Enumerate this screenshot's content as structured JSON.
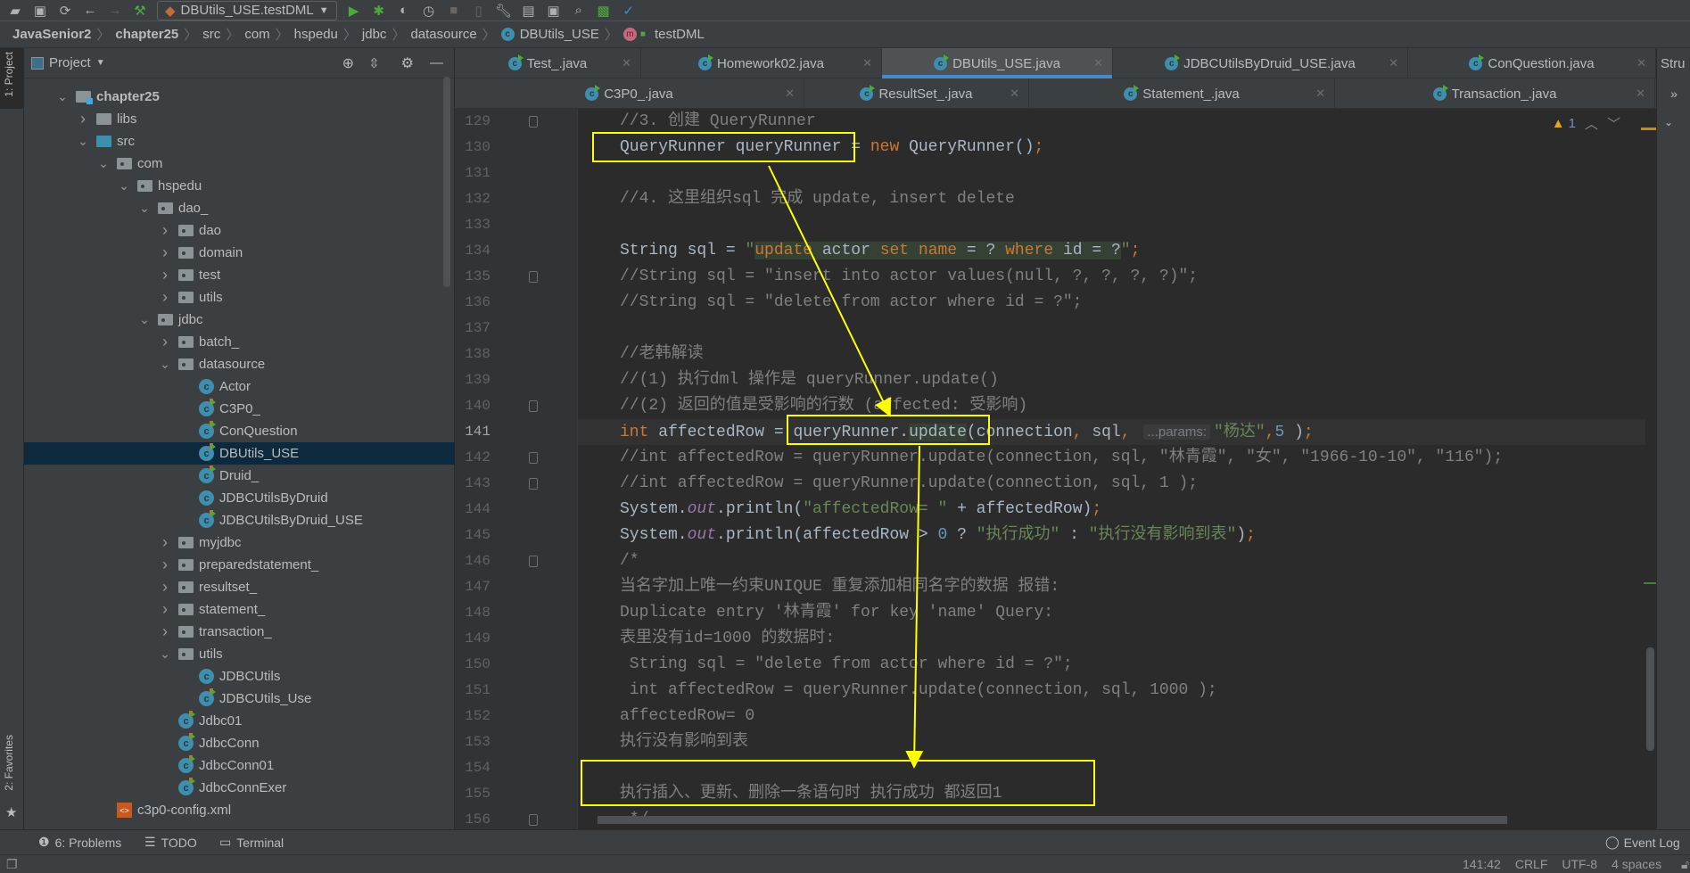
{
  "toolbar": {
    "run_config": "DBUtils_USE.testDML"
  },
  "breadcrumb": [
    "JavaSenior2",
    "chapter25",
    "src",
    "com",
    "hspedu",
    "jdbc",
    "datasource",
    "DBUtils_USE",
    "testDML"
  ],
  "left_strip": {
    "project_tab": "1: Project",
    "favorites_tab": "2: Favorites"
  },
  "project_panel": {
    "title": "Project",
    "tree": [
      {
        "label": "chapter25",
        "level": 0,
        "kind": "module",
        "expanded": true
      },
      {
        "label": "libs",
        "level": 1,
        "kind": "folder",
        "expanded": false
      },
      {
        "label": "src",
        "level": 1,
        "kind": "src",
        "expanded": true
      },
      {
        "label": "com",
        "level": 2,
        "kind": "pkg",
        "expanded": true
      },
      {
        "label": "hspedu",
        "level": 3,
        "kind": "pkg",
        "expanded": true
      },
      {
        "label": "dao_",
        "level": 4,
        "kind": "pkg",
        "expanded": true
      },
      {
        "label": "dao",
        "level": 5,
        "kind": "pkg",
        "expanded": false
      },
      {
        "label": "domain",
        "level": 5,
        "kind": "pkg",
        "expanded": false
      },
      {
        "label": "test",
        "level": 5,
        "kind": "pkg",
        "expanded": false
      },
      {
        "label": "utils",
        "level": 5,
        "kind": "pkg",
        "expanded": false
      },
      {
        "label": "jdbc",
        "level": 4,
        "kind": "pkg",
        "expanded": true
      },
      {
        "label": "batch_",
        "level": 5,
        "kind": "pkg",
        "expanded": false
      },
      {
        "label": "datasource",
        "level": 5,
        "kind": "pkg",
        "expanded": true
      },
      {
        "label": "Actor",
        "level": 6,
        "kind": "class"
      },
      {
        "label": "C3P0_",
        "level": 6,
        "kind": "class-run"
      },
      {
        "label": "ConQuestion",
        "level": 6,
        "kind": "class-run"
      },
      {
        "label": "DBUtils_USE",
        "level": 6,
        "kind": "class-run",
        "selected": true
      },
      {
        "label": "Druid_",
        "level": 6,
        "kind": "class-run"
      },
      {
        "label": "JDBCUtilsByDruid",
        "level": 6,
        "kind": "class"
      },
      {
        "label": "JDBCUtilsByDruid_USE",
        "level": 6,
        "kind": "class-run"
      },
      {
        "label": "myjdbc",
        "level": 5,
        "kind": "pkg",
        "expanded": false
      },
      {
        "label": "preparedstatement_",
        "level": 5,
        "kind": "pkg",
        "expanded": false
      },
      {
        "label": "resultset_",
        "level": 5,
        "kind": "pkg",
        "expanded": false
      },
      {
        "label": "statement_",
        "level": 5,
        "kind": "pkg",
        "expanded": false
      },
      {
        "label": "transaction_",
        "level": 5,
        "kind": "pkg",
        "expanded": false
      },
      {
        "label": "utils",
        "level": 5,
        "kind": "pkg",
        "expanded": true
      },
      {
        "label": "JDBCUtils",
        "level": 6,
        "kind": "class"
      },
      {
        "label": "JDBCUtils_Use",
        "level": 6,
        "kind": "class-run"
      },
      {
        "label": "Jdbc01",
        "level": 5,
        "kind": "class-run"
      },
      {
        "label": "JdbcConn",
        "level": 5,
        "kind": "class-run"
      },
      {
        "label": "JdbcConn01",
        "level": 5,
        "kind": "class-run"
      },
      {
        "label": "JdbcConnExer",
        "level": 5,
        "kind": "class-run"
      },
      {
        "label": "c3p0-config.xml",
        "level": 2,
        "kind": "xml"
      }
    ]
  },
  "tabs_row1": [
    {
      "label": "Test_.java",
      "w": 209
    },
    {
      "label": "Homework02.java",
      "w": 270
    },
    {
      "label": "DBUtils_USE.java",
      "w": 259,
      "active": true
    },
    {
      "label": "JDBCUtilsByDruid_USE.java",
      "w": 331
    },
    {
      "label": "ConQuestion.java",
      "w": 278
    }
  ],
  "tabs_row2": [
    {
      "label": "C3P0_.java",
      "w": 392
    },
    {
      "label": "ResultSet_.java",
      "w": 252
    },
    {
      "label": "Statement_.java",
      "w": 343
    },
    {
      "label": "Transaction_.java",
      "w": 359
    }
  ],
  "structure_tab": "Stru",
  "more_tabs": "»",
  "editor": {
    "warning_count": "1",
    "current_line": 141,
    "folds": [
      129,
      135,
      140,
      142,
      143,
      146,
      156
    ],
    "lines": [
      {
        "n": 129,
        "tokens": [
          {
            "t": "//3. 创建 QueryRunner",
            "c": "cm"
          }
        ]
      },
      {
        "n": 130,
        "tokens": [
          {
            "t": "QueryRunner queryRunner = "
          },
          {
            "t": "new ",
            "c": "kw"
          },
          {
            "t": "QueryRunner()"
          },
          {
            "t": ";",
            "c": "kw"
          }
        ]
      },
      {
        "n": 131,
        "tokens": []
      },
      {
        "n": 132,
        "tokens": [
          {
            "t": "//4. 这里组织sql 完成 update, insert delete",
            "c": "cm"
          }
        ]
      },
      {
        "n": 133,
        "tokens": []
      },
      {
        "n": 134,
        "tokens": [
          {
            "t": "String sql = "
          },
          {
            "t": "\"",
            "c": "str"
          },
          {
            "t": "update",
            "c": "kw sqlbg"
          },
          {
            "t": " actor ",
            "c": "sqlbg"
          },
          {
            "t": "set name",
            "c": "kw sqlbg"
          },
          {
            "t": " = ? ",
            "c": "sqlbg"
          },
          {
            "t": "where",
            "c": "kw sqlbg"
          },
          {
            "t": " id = ?",
            "c": "sqlbg"
          },
          {
            "t": "\"",
            "c": "str"
          },
          {
            "t": ";",
            "c": "kw"
          }
        ]
      },
      {
        "n": 135,
        "tokens": [
          {
            "t": "//String sql = \"insert into actor values(null, ?, ?, ?, ?)\";",
            "c": "cm"
          }
        ]
      },
      {
        "n": 136,
        "tokens": [
          {
            "t": "//String sql = \"delete from actor where id = ?\";",
            "c": "cm"
          }
        ]
      },
      {
        "n": 137,
        "tokens": []
      },
      {
        "n": 138,
        "tokens": [
          {
            "t": "//老韩解读",
            "c": "cm"
          }
        ]
      },
      {
        "n": 139,
        "tokens": [
          {
            "t": "//(1) 执行dml 操作是 queryRunner.update()",
            "c": "cm"
          }
        ]
      },
      {
        "n": 140,
        "tokens": [
          {
            "t": "//(2) 返回的值是受影响的行数 (affected: 受影响)",
            "c": "cm"
          }
        ]
      },
      {
        "n": 141,
        "tokens": [
          {
            "t": "int ",
            "c": "kw"
          },
          {
            "t": "affectedRow = queryRunner."
          },
          {
            "t": "update",
            "c": "upd"
          },
          {
            "t": "(connection"
          },
          {
            "t": ", ",
            "c": "kw"
          },
          {
            "t": "sql"
          },
          {
            "t": ", ",
            "c": "kw"
          },
          {
            "t": "...params:",
            "c": "hint"
          },
          {
            "t": "\"杨达\"",
            "c": "str"
          },
          {
            "t": ",",
            "c": "kw"
          },
          {
            "t": "5",
            "c": "num"
          },
          {
            "t": " )"
          },
          {
            "t": ";",
            "c": "kw"
          }
        ]
      },
      {
        "n": 142,
        "tokens": [
          {
            "t": "//int affectedRow = queryRunner.update(connection, sql, \"林青霞\", \"女\", \"1966-10-10\", \"116\");",
            "c": "cm"
          }
        ]
      },
      {
        "n": 143,
        "tokens": [
          {
            "t": "//int affectedRow = queryRunner.update(connection, sql, 1 );",
            "c": "cm"
          }
        ]
      },
      {
        "n": 144,
        "tokens": [
          {
            "t": "System."
          },
          {
            "t": "out",
            "c": "fld"
          },
          {
            "t": ".println("
          },
          {
            "t": "\"affectedRow= \"",
            "c": "str"
          },
          {
            "t": " + affectedRow)"
          },
          {
            "t": ";",
            "c": "kw"
          }
        ]
      },
      {
        "n": 145,
        "tokens": [
          {
            "t": "System."
          },
          {
            "t": "out",
            "c": "fld"
          },
          {
            "t": ".println(affectedRow > "
          },
          {
            "t": "0",
            "c": "num"
          },
          {
            "t": " ? "
          },
          {
            "t": "\"执行成功\"",
            "c": "str"
          },
          {
            "t": " : "
          },
          {
            "t": "\"执行没有影响到表\"",
            "c": "str"
          },
          {
            "t": ")"
          },
          {
            "t": ";",
            "c": "kw"
          }
        ]
      },
      {
        "n": 146,
        "tokens": [
          {
            "t": "/*",
            "c": "cm"
          }
        ]
      },
      {
        "n": 147,
        "tokens": [
          {
            "t": "当名字加上唯一约束UNIQUE 重复添加相同名字的数据 报错:",
            "c": "cm"
          }
        ]
      },
      {
        "n": 148,
        "tokens": [
          {
            "t": "Duplicate entry '林青霞' for key 'name' Query:",
            "c": "cm"
          }
        ]
      },
      {
        "n": 149,
        "tokens": [
          {
            "t": "表里没有id=1000 的数据时:",
            "c": "cm"
          }
        ]
      },
      {
        "n": 150,
        "tokens": [
          {
            "t": " String sql = \"delete from actor where id = ?\";",
            "c": "cm"
          }
        ]
      },
      {
        "n": 151,
        "tokens": [
          {
            "t": " int affectedRow = queryRunner.update(connection, sql, 1000 );",
            "c": "cm"
          }
        ]
      },
      {
        "n": 152,
        "tokens": [
          {
            "t": "affectedRow= 0",
            "c": "cm"
          }
        ]
      },
      {
        "n": 153,
        "tokens": [
          {
            "t": "执行没有影响到表",
            "c": "cm"
          }
        ]
      },
      {
        "n": 154,
        "tokens": []
      },
      {
        "n": 155,
        "tokens": [
          {
            "t": "执行插入、更新、删除一条语句时 执行成功 都返回1",
            "c": "cm"
          }
        ]
      },
      {
        "n": 156,
        "tokens": [
          {
            "t": " */",
            "c": "cm"
          }
        ]
      }
    ]
  },
  "bottom_tools": [
    {
      "label": "6: Problems",
      "icon": "problems-icon"
    },
    {
      "label": "TODO",
      "icon": "todo-icon"
    },
    {
      "label": "Terminal",
      "icon": "terminal-icon"
    }
  ],
  "event_log": "Event Log",
  "status": {
    "position": "141:42",
    "line_sep": "CRLF",
    "encoding": "UTF-8",
    "indent": "4 spaces"
  },
  "colors": {
    "annotation": "#ffff00",
    "accent": "#4a88c7",
    "selection": "#0d293e"
  }
}
